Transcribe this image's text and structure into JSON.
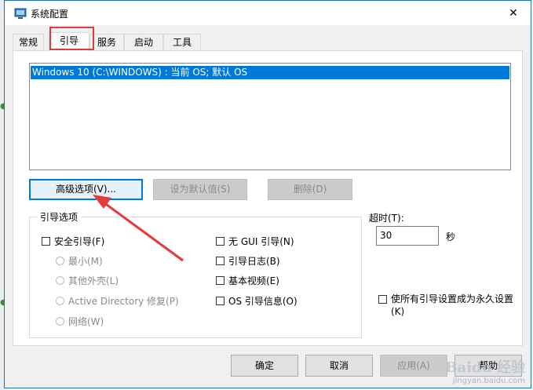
{
  "window": {
    "title": "系统配置",
    "close_glyph": "✕"
  },
  "tabs": [
    {
      "label": "常规",
      "active": false
    },
    {
      "label": "引导",
      "active": true
    },
    {
      "label": "服务",
      "active": false
    },
    {
      "label": "启动",
      "active": false
    },
    {
      "label": "工具",
      "active": false
    }
  ],
  "os_list": {
    "items": [
      "Windows 10 (C:\\WINDOWS) : 当前 OS; 默认 OS"
    ]
  },
  "buttons": {
    "advanced": "高级选项(V)...",
    "set_default": "设为默认值(S)",
    "delete": "删除(D)"
  },
  "boot_options": {
    "group_label": "引导选项",
    "safe_boot": "安全引导(F)",
    "minimal": "最小(M)",
    "alternate_shell": "其他外壳(L)",
    "ad_repair": "Active Directory 修复(P)",
    "network": "网络(W)",
    "no_gui": "无 GUI 引导(N)",
    "boot_log": "引导日志(B)",
    "base_video": "基本视频(E)",
    "os_boot_info": "OS 引导信息(O)"
  },
  "timeout": {
    "label": "超时(T):",
    "value": "30",
    "unit": "秒"
  },
  "permanent": {
    "label": "使所有引导设置成为永久设置(K)"
  },
  "footer": {
    "ok": "确定",
    "cancel": "取消",
    "apply": "应用(A)",
    "help": "帮助"
  },
  "watermark": {
    "logo": "Baidu 经验",
    "url": "jingyan.baidu.com"
  },
  "colors": {
    "selection": "#0078d7",
    "annotation": "#e23b3b"
  }
}
